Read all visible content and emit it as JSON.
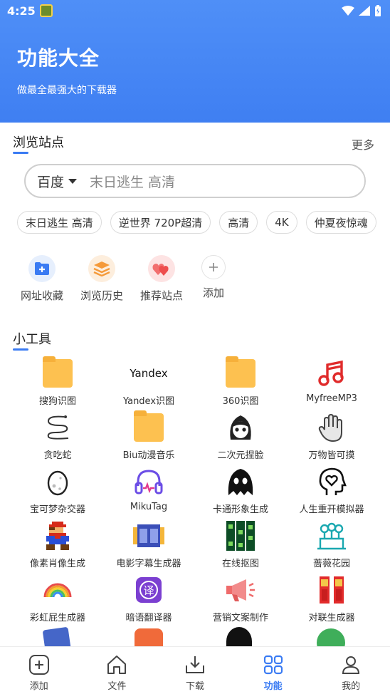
{
  "status": {
    "time": "4:25"
  },
  "header": {
    "title": "功能大全",
    "subtitle": "做最全最强大的下载器"
  },
  "browse": {
    "title": "浏览站点",
    "more": "更多",
    "search": {
      "engine": "百度",
      "query": "末日逃生 高清"
    },
    "chips": [
      "末日逃生 高清",
      "逆世界 720P超清",
      "高清",
      "4K",
      "仲夏夜惊魂"
    ],
    "quick": [
      {
        "label": "网址收藏",
        "icon": "bookmark-plus-icon",
        "color": "#3a7bf3"
      },
      {
        "label": "浏览历史",
        "icon": "layers-icon",
        "color": "#f59a3a"
      },
      {
        "label": "推荐站点",
        "icon": "hearts-icon",
        "color": "#f05a5a"
      },
      {
        "label": "添加",
        "icon": "plus-icon",
        "color": "#888888"
      }
    ]
  },
  "tools": {
    "title": "小工具",
    "items": [
      {
        "label": "搜狗识图",
        "icon": "folder-icon"
      },
      {
        "label": "Yandex识图",
        "icon": "yandex-logo",
        "logo_text": "Yandex"
      },
      {
        "label": "360识图",
        "icon": "folder-icon"
      },
      {
        "label": "MyfreeMP3",
        "icon": "music-note-icon"
      },
      {
        "label": "贪吃蛇",
        "icon": "snake-icon"
      },
      {
        "label": "Biu动漫音乐",
        "icon": "folder-icon"
      },
      {
        "label": "二次元捏脸",
        "icon": "anime-face-icon"
      },
      {
        "label": "万物皆可摸",
        "icon": "hand-icon"
      },
      {
        "label": "宝可梦杂交器",
        "icon": "egg-icon"
      },
      {
        "label": "MikuTag",
        "icon": "headphones-icon"
      },
      {
        "label": "卡通形象生成",
        "icon": "ghost-icon"
      },
      {
        "label": "人生重开模拟器",
        "icon": "head-heart-icon"
      },
      {
        "label": "像素肖像生成",
        "icon": "pixel-mario-icon"
      },
      {
        "label": "电影字幕生成器",
        "icon": "film-strip-icon"
      },
      {
        "label": "在线抠图",
        "icon": "film-grid-icon"
      },
      {
        "label": "蔷薇花园",
        "icon": "garden-icon"
      },
      {
        "label": "彩虹屁生成器",
        "icon": "rainbow-icon"
      },
      {
        "label": "暗语翻译器",
        "icon": "translate-icon",
        "logo_text": "译"
      },
      {
        "label": "营销文案制作",
        "icon": "megaphone-icon"
      },
      {
        "label": "对联生成器",
        "icon": "couplet-icon"
      }
    ]
  },
  "nav": [
    {
      "label": "添加",
      "icon": "add-square-icon"
    },
    {
      "label": "文件",
      "icon": "home-icon"
    },
    {
      "label": "下载",
      "icon": "download-icon"
    },
    {
      "label": "功能",
      "icon": "grid-icon",
      "active": true
    },
    {
      "label": "我的",
      "icon": "person-icon"
    }
  ],
  "colors": {
    "primary": "#3a7bf3",
    "header": "#4f8ff7"
  }
}
